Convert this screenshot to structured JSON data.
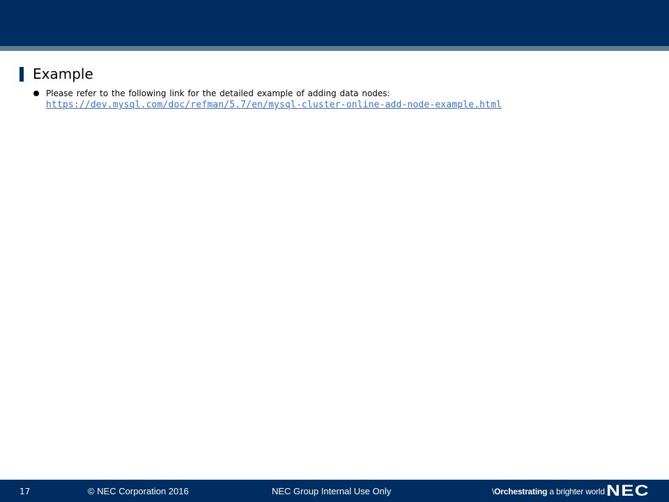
{
  "slide": {
    "title": "Example",
    "bullets": [
      {
        "text": "Please refer to the following link for the detailed example of adding data nodes:",
        "link": "https://dev.mysql.com/doc/refman/5.7/en/mysql-cluster-online-add-node-example.html"
      }
    ]
  },
  "footer": {
    "page_number": "17",
    "copyright": "© NEC Corporation 2016",
    "classification": "NEC Group Internal Use Only",
    "tagline_prefix": "\\",
    "tagline_bold": "Orchestrating",
    "tagline_rest": " a brighter world",
    "logo": "NEC"
  },
  "colors": {
    "brand_navy": "#002d62",
    "stripe": "#5a7f92",
    "link": "#3a6fd0"
  }
}
